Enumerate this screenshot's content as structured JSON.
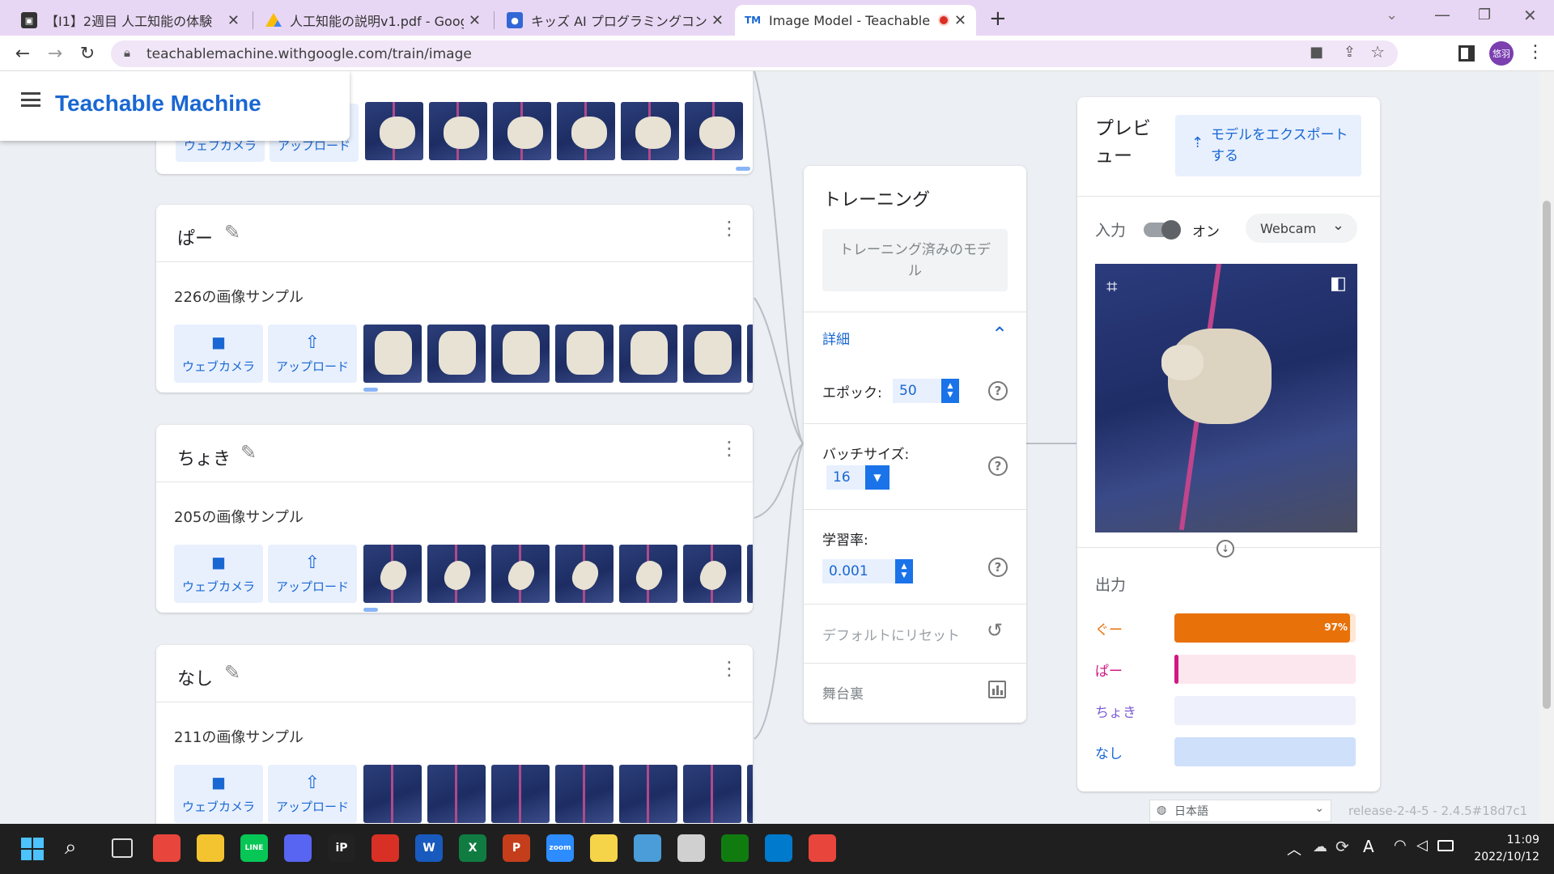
{
  "browser": {
    "tabs": [
      {
        "title": "【I1】2週目 人工知能の体験",
        "favicon_color": "#333333",
        "favicon": "classroom-icon",
        "active": false
      },
      {
        "title": "人工知能の説明v1.pdf - Google ドライブ",
        "favicon_color": "#fbbc04",
        "favicon": "drive-icon",
        "active": false
      },
      {
        "title": "キッズ AI プログラミングコンテスト",
        "favicon_color": "#3367d6",
        "favicon": "contest-icon",
        "active": false
      },
      {
        "title": "Image Model - Teachable Machine",
        "favicon_color": "#1967d2",
        "favicon": "tm-icon",
        "favicon_text": "TM",
        "active": true
      }
    ],
    "new_tab": "+",
    "url": "teachablemachine.withgoogle.com/train/image",
    "profile": "悠羽"
  },
  "app": {
    "title": "Teachable Machine",
    "menu_icon": "hamburger-icon"
  },
  "first_class": {
    "webcam": "ウェブカメラ",
    "upload": "アップロード"
  },
  "classes": [
    {
      "name": "ぱー",
      "count": "226の画像サンプル",
      "webcam": "ウェブカメラ",
      "upload": "アップロード",
      "gesture": "paper"
    },
    {
      "name": "ちょき",
      "count": "205の画像サンプル",
      "webcam": "ウェブカメラ",
      "upload": "アップロード",
      "gesture": "scissors"
    },
    {
      "name": "なし",
      "count": "211の画像サンプル",
      "webcam": "ウェブカメラ",
      "upload": "アップロード",
      "gesture": "none"
    }
  ],
  "training": {
    "title": "トレーニング",
    "trained_button": "トレーニング済みのモデル",
    "advanced": "詳細",
    "epochs_label": "エポック:",
    "epochs": "50",
    "batch_label": "バッチサイズ:",
    "batch": "16",
    "lr_label": "学習率:",
    "lr": "0.001",
    "reset": "デフォルトにリセット",
    "under_hood": "舞台裏"
  },
  "preview": {
    "title": "プレビュー",
    "export": "モデルをエクスポートする",
    "input_label": "入力",
    "toggle_state": "オン",
    "source": "Webcam",
    "output_label": "出力",
    "outputs": [
      {
        "label": "ぐー",
        "percent": 97,
        "percent_text": "97%",
        "color": "#e8710a",
        "track": "#fce8d5",
        "text_color": "#e8710a"
      },
      {
        "label": "ぱー",
        "percent": 1,
        "percent_text": "",
        "color": "#d01884",
        "track": "#fde7ee",
        "text_color": "#d01884"
      },
      {
        "label": "ちょき",
        "percent": 0,
        "percent_text": "",
        "color": "#8e24aa",
        "track": "#eef0fb",
        "text_color": "#7b5cd6"
      },
      {
        "label": "なし",
        "percent": 0,
        "percent_text": "",
        "color": "#1967d2",
        "track": "#cfe0fb",
        "text_color": "#1967d2"
      }
    ]
  },
  "footer": {
    "language": "日本語",
    "version": "release-2-4-5 - 2.4.5#18d7c1"
  },
  "taskbar": {
    "time": "11:09",
    "date": "2022/10/12",
    "apps": [
      {
        "name": "chrome-icon",
        "color": "#e8453c",
        "text": ""
      },
      {
        "name": "file-explorer-icon",
        "color": "#f4c430",
        "text": ""
      },
      {
        "name": "line-icon",
        "color": "#06c755",
        "text": "LINE"
      },
      {
        "name": "discord-icon",
        "color": "#5865f2",
        "text": ""
      },
      {
        "name": "ibis-icon",
        "color": "#222222",
        "text": "iP"
      },
      {
        "name": "acrobat-icon",
        "color": "#d93025",
        "text": ""
      },
      {
        "name": "word-icon",
        "color": "#185abd",
        "text": "W"
      },
      {
        "name": "excel-icon",
        "color": "#107c41",
        "text": "X"
      },
      {
        "name": "powerpoint-icon",
        "color": "#c43e1c",
        "text": "P"
      },
      {
        "name": "zoom-icon",
        "color": "#2d8cff",
        "text": "zoom"
      },
      {
        "name": "sticky-notes-icon",
        "color": "#f6d44a",
        "text": ""
      },
      {
        "name": "photos-icon",
        "color": "#4a9dd8",
        "text": ""
      },
      {
        "name": "snipping-tool-icon",
        "color": "#d0d0d0",
        "text": ""
      },
      {
        "name": "xbox-icon",
        "color": "#107c10",
        "text": ""
      },
      {
        "name": "vscode-icon",
        "color": "#007acc",
        "text": ""
      },
      {
        "name": "chrome-profile-icon",
        "color": "#e8453c",
        "text": ""
      }
    ]
  }
}
